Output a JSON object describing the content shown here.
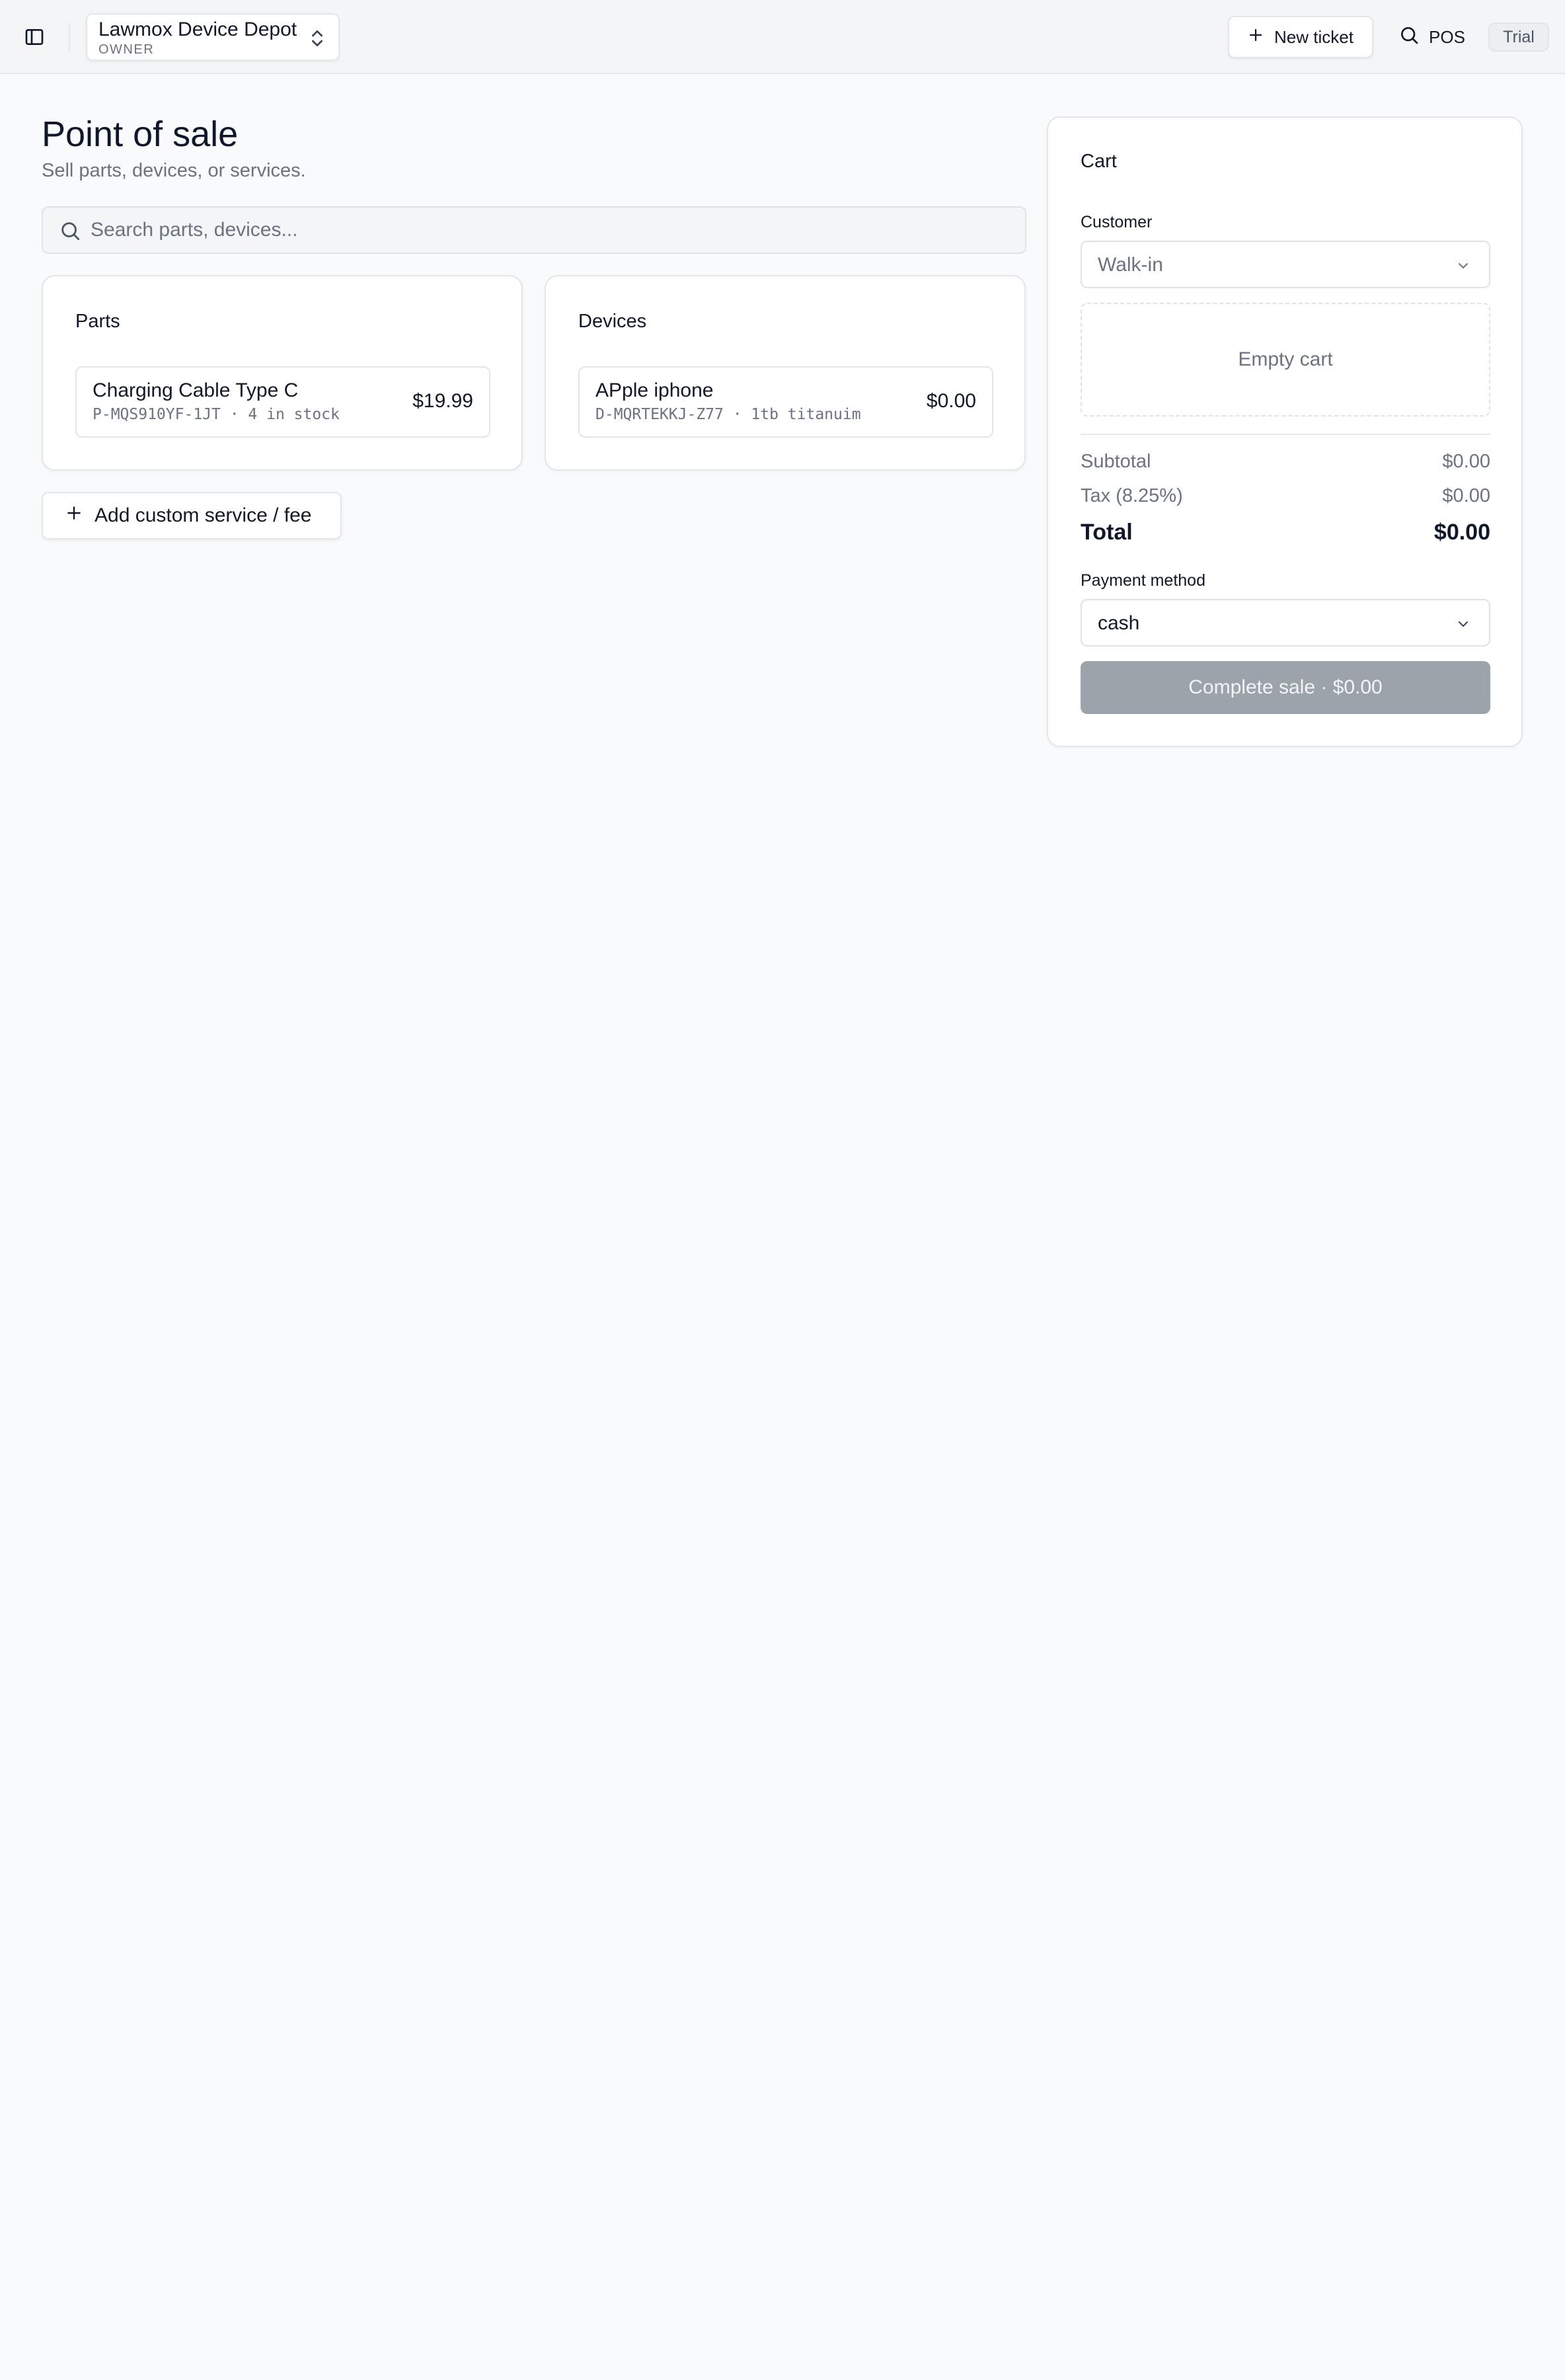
{
  "header": {
    "workspace": {
      "name": "Lawmox Device Depot",
      "role": "OWNER"
    },
    "new_ticket_label": "New ticket",
    "pos_label": "POS",
    "trial_badge": "Trial"
  },
  "page": {
    "title": "Point of sale",
    "subtitle": "Sell parts, devices, or services.",
    "search": {
      "placeholder": "Search parts, devices...",
      "value": ""
    }
  },
  "parts": {
    "title": "Parts",
    "items": [
      {
        "name": "Charging Cable Type C",
        "meta": "P-MQS910YF-1JT · 4 in stock",
        "price": "$19.99"
      }
    ]
  },
  "devices": {
    "title": "Devices",
    "items": [
      {
        "name": "APple iphone",
        "meta": "D-MQRTEKKJ-Z77 · 1tb titanuim",
        "price": "$0.00"
      }
    ]
  },
  "custom_service_label": "Add custom service / fee",
  "cart": {
    "title": "Cart",
    "customer_label": "Customer",
    "customer_value": "Walk-in",
    "empty_text": "Empty cart",
    "subtotal_label": "Subtotal",
    "subtotal_value": "$0.00",
    "tax_label": "Tax (8.25%)",
    "tax_value": "$0.00",
    "total_label": "Total",
    "total_value": "$0.00",
    "payment_label": "Payment method",
    "payment_value": "cash",
    "complete_label": "Complete sale · $0.00"
  },
  "icons": {
    "sidebar": "sidebar-toggle-icon",
    "switcher": "chevrons-up-down-icon",
    "plus": "plus-icon",
    "search": "search-icon",
    "dropdown": "chevron-down-icon"
  },
  "colors": {
    "background": "#f8fafb",
    "complete_button_disabled": "#9ca3ab",
    "muted_text": "#6b7280"
  }
}
